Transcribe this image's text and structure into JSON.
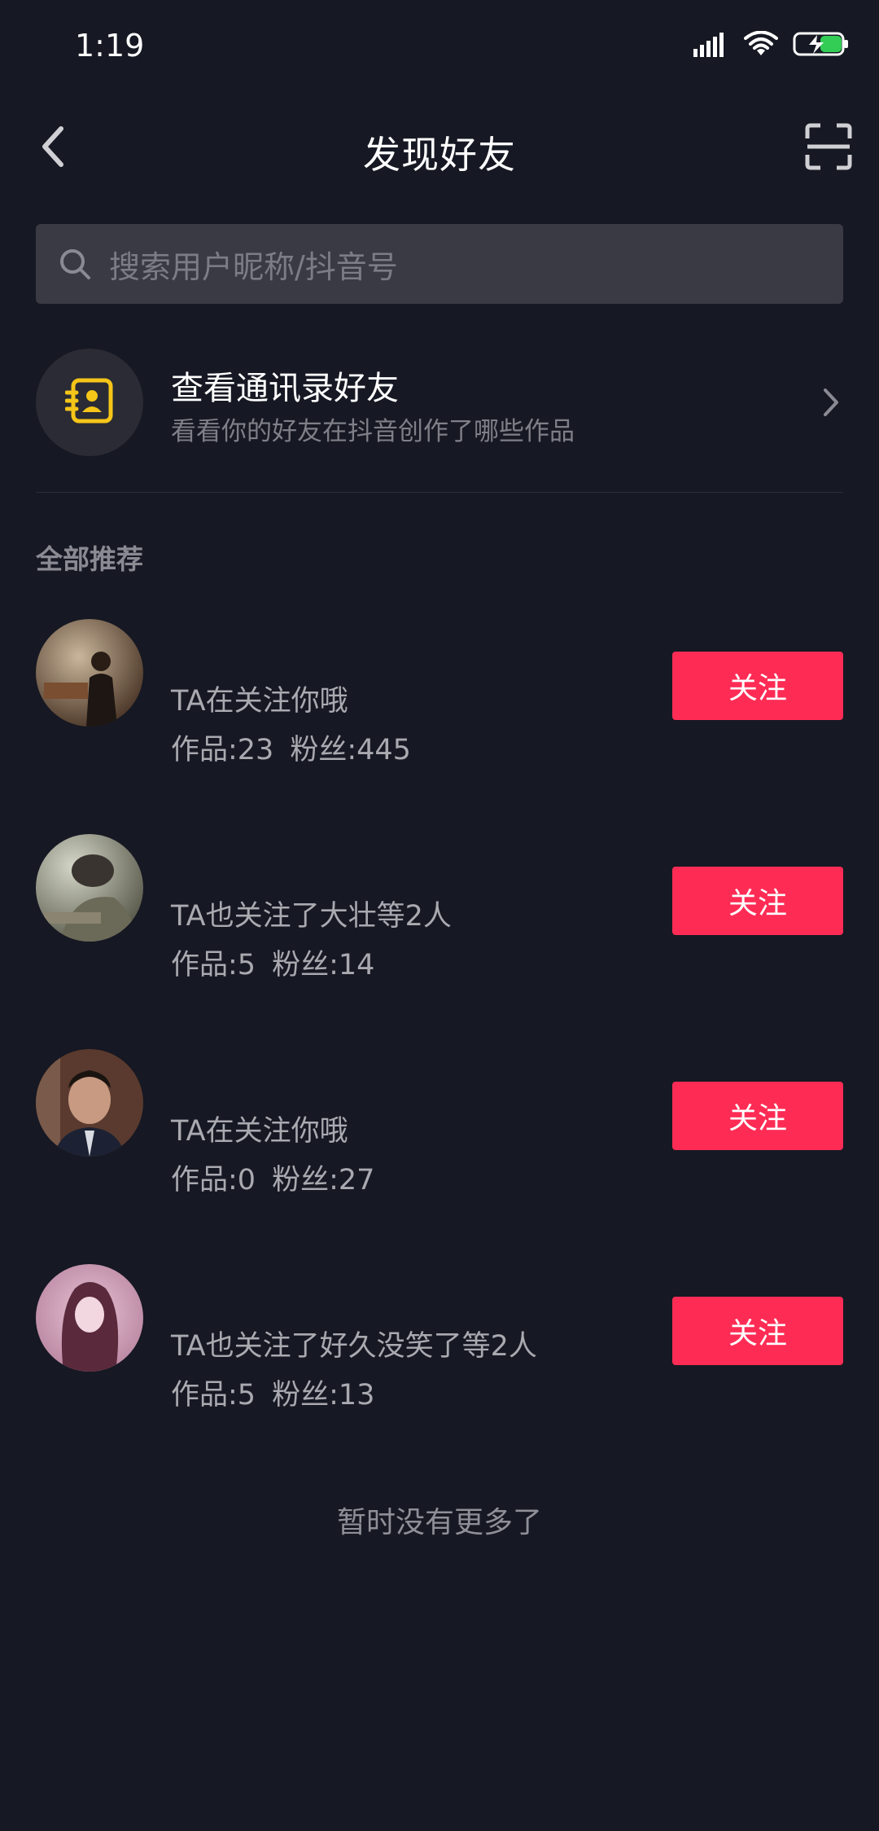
{
  "status_bar": {
    "time": "1:19"
  },
  "header": {
    "title": "发现好友"
  },
  "search": {
    "placeholder": "搜索用户昵称/抖音号"
  },
  "contacts": {
    "title": "查看通讯录好友",
    "subtitle": "看看你的好友在抖音创作了哪些作品"
  },
  "section_title": "全部推荐",
  "users": [
    {
      "desc": "TA在关注你哦",
      "works": "作品:23",
      "fans": "粉丝:445",
      "follow_label": "关注"
    },
    {
      "desc": "TA也关注了大壮等2人",
      "works": "作品:5",
      "fans": "粉丝:14",
      "follow_label": "关注"
    },
    {
      "desc": "TA在关注你哦",
      "works": "作品:0",
      "fans": "粉丝:27",
      "follow_label": "关注"
    },
    {
      "desc": "TA也关注了好久没笑了等2人",
      "works": "作品:5",
      "fans": "粉丝:13",
      "follow_label": "关注"
    }
  ],
  "footer": {
    "no_more": "暂时没有更多了"
  },
  "colors": {
    "background": "#161823",
    "accent": "#fe2c55",
    "contacts_icon": "#f5c518"
  },
  "icons": [
    "signal-icon",
    "wifi-icon",
    "battery-icon",
    "back-arrow-icon",
    "scan-icon",
    "search-icon",
    "contact-book-icon",
    "chevron-right-icon"
  ]
}
